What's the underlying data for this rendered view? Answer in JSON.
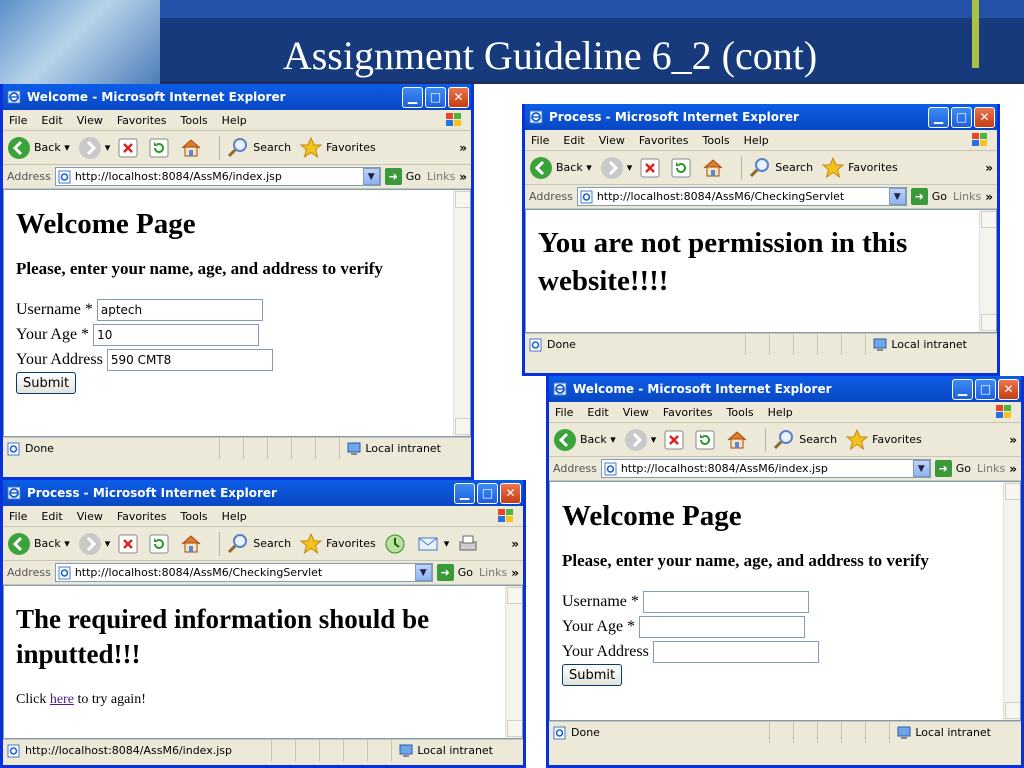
{
  "slide": {
    "title": "Assignment Guideline 6_2 (cont)"
  },
  "menu": [
    "File",
    "Edit",
    "View",
    "Favorites",
    "Tools",
    "Help"
  ],
  "toolbar": {
    "back": "Back",
    "search": "Search",
    "favorites": "Favorites"
  },
  "address": {
    "label": "Address",
    "go": "Go",
    "links": "Links"
  },
  "windows": {
    "w1": {
      "title": "Welcome - Microsoft Internet Explorer",
      "url": "http://localhost:8084/AssM6/index.jsp",
      "heading": "Welcome Page",
      "instruction": "Please, enter your name, age, and address to verify",
      "labels": {
        "username": "Username *",
        "age": "Your Age *",
        "address": "Your Address"
      },
      "values": {
        "username": "aptech",
        "age": "10",
        "address": "590 CMT8"
      },
      "submit": "Submit",
      "status": "Done",
      "zone": "Local intranet"
    },
    "w2": {
      "title": "Process - Microsoft Internet Explorer",
      "url": "http://localhost:8084/AssM6/CheckingServlet",
      "message": "You are not permission in this website!!!!",
      "status": "Done",
      "zone": "Local intranet"
    },
    "w3": {
      "title": "Process - Microsoft Internet Explorer",
      "url": "http://localhost:8084/AssM6/CheckingServlet",
      "message": "The required information should be inputted!!!",
      "click_prefix": "Click ",
      "link": "here",
      "click_suffix": " to try again!",
      "status": "http://localhost:8084/AssM6/index.jsp",
      "zone": "Local intranet"
    },
    "w4": {
      "title": "Welcome - Microsoft Internet Explorer",
      "url": "http://localhost:8084/AssM6/index.jsp",
      "heading": "Welcome Page",
      "instruction": "Please, enter your name, age, and address to verify",
      "labels": {
        "username": "Username *",
        "age": "Your Age *",
        "address": "Your Address"
      },
      "values": {
        "username": "",
        "age": "",
        "address": ""
      },
      "submit": "Submit",
      "status": "Done",
      "zone": "Local intranet"
    }
  }
}
